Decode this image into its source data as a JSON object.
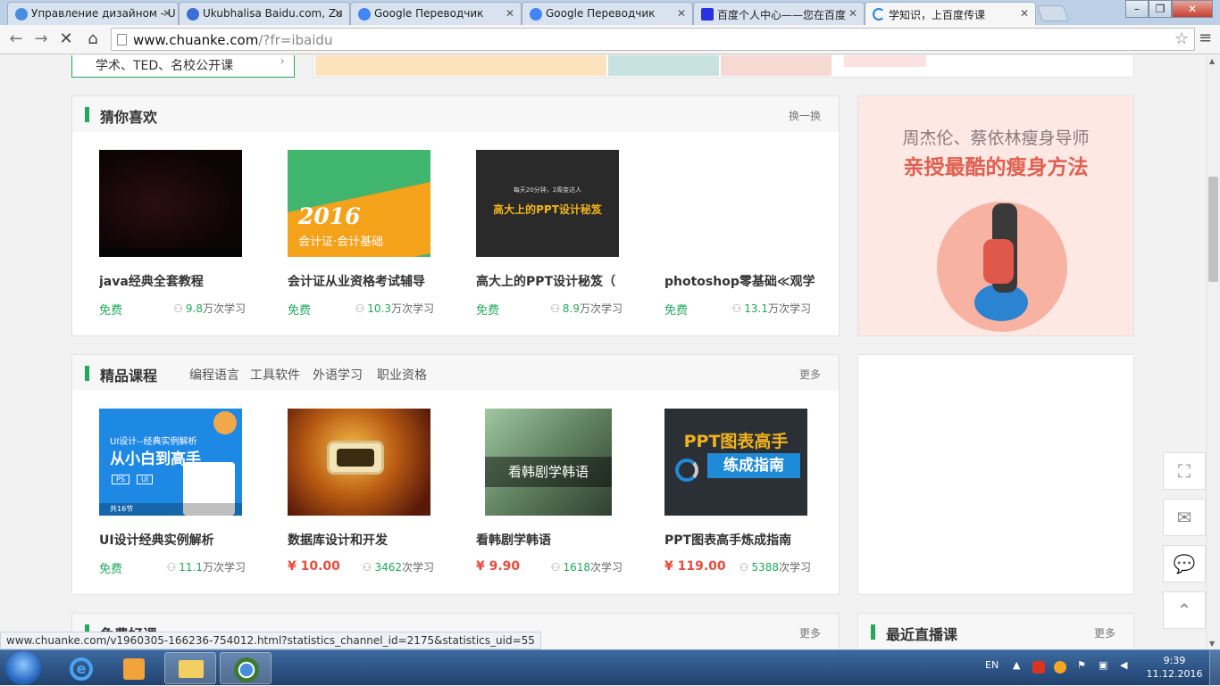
{
  "browser": {
    "tabs": [
      {
        "title": "Управление дизайном - U",
        "favicon_color": "#4a8de0"
      },
      {
        "title": "Ukubhalisa Baidu.com, Zu",
        "favicon_color": "#3b6fd6"
      },
      {
        "title": "Google Переводчик",
        "favicon_color": "#4285f4"
      },
      {
        "title": "Google Переводчик",
        "favicon_color": "#4285f4"
      },
      {
        "title": "百度个人中心——您在百度",
        "favicon_color": "#2932e1"
      },
      {
        "title": "学知识，上百度传课",
        "favicon_color": "#1e88e5",
        "active": true
      }
    ],
    "url": "www.chuanke.com",
    "url_path": "/?fr=ibaidu",
    "status_url": "www.chuanke.com/v1960305-166236-754012.html?statistics_channel_id=2175&statistics_uid=55"
  },
  "top": {
    "category_link": "学术、TED、名校公开课"
  },
  "guess": {
    "title": "猜你喜欢",
    "action": "换一换",
    "courses": [
      {
        "title": "java经典全套教程",
        "price": "免费",
        "count": "9.8",
        "unit": "万",
        "suffix": "次学习"
      },
      {
        "title": "会计证从业资格考试辅导",
        "price": "免费",
        "count": "10.3",
        "unit": "万",
        "suffix": "次学习"
      },
      {
        "title": "高大上的PPT设计秘笈（",
        "price": "免费",
        "count": "8.9",
        "unit": "万",
        "suffix": "次学习"
      },
      {
        "title": "photoshop零基础≪观学",
        "price": "免费",
        "count": "13.1",
        "unit": "万",
        "suffix": "次学习"
      }
    ],
    "thumb_texts": {
      "accounting_year": "2016",
      "accounting_sub": "会计证·会计基础",
      "ppt_line1": "每天20分钟，2周变达人",
      "ppt_line2": "高大上的PPT设计秘笈"
    }
  },
  "ad": {
    "line1": "周杰伦、蔡依林瘦身导师",
    "line2": "亲授最酷的瘦身方法"
  },
  "featured": {
    "title": "精品课程",
    "tabs": [
      "编程语言",
      "工具软件",
      "外语学习",
      "职业资格"
    ],
    "more": "更多",
    "courses": [
      {
        "title": "UI设计经典实例解析",
        "price": "免费",
        "paid": false,
        "count": "11.1",
        "unit": "万",
        "suffix": "次学习"
      },
      {
        "title": "数据库设计和开发",
        "price": "¥ 10.00",
        "paid": true,
        "count": "3462",
        "unit": "",
        "suffix": "次学习"
      },
      {
        "title": "看韩剧学韩语",
        "price": "¥ 9.90",
        "paid": true,
        "count": "1618",
        "unit": "",
        "suffix": "次学习"
      },
      {
        "title": "PPT图表高手炼成指南",
        "price": "¥ 119.00",
        "paid": true,
        "count": "5388",
        "unit": "",
        "suffix": "次学习"
      }
    ],
    "thumb_texts": {
      "ui_line1": "UI设计--经典实例解析",
      "ui_line2": "从小白到高手",
      "ui_tag1": "PS",
      "ui_tag2": "UI",
      "ui_lessons": "共16节",
      "korean": "看韩剧学韩语",
      "ppt_a": "PPT图表高手",
      "ppt_b": "练成指南"
    }
  },
  "free": {
    "title": "免费好课",
    "more": "更多"
  },
  "live": {
    "title": "最近直播课",
    "more": "更多"
  },
  "taskbar": {
    "lang": "EN",
    "time": "9:39",
    "date": "11.12.2016"
  }
}
